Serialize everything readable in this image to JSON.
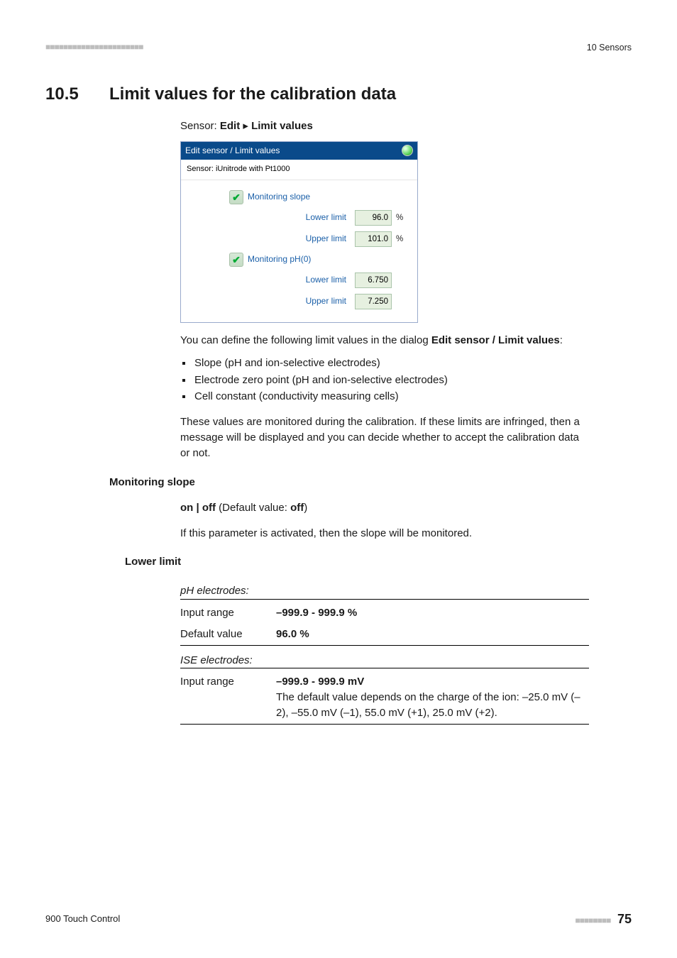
{
  "header": {
    "chapter_ref": "10 Sensors"
  },
  "section": {
    "number": "10.5",
    "title": "Limit values for the calibration data"
  },
  "breadcrumb": {
    "prefix": "Sensor: ",
    "b1": "Edit",
    "sep": " ▸ ",
    "b2": "Limit values"
  },
  "panel": {
    "title": "Edit sensor / Limit values",
    "sensor_line": "Sensor:  iUnitrode with Pt1000",
    "mon_slope_label": "Monitoring slope",
    "lower_label": "Lower limit",
    "upper_label": "Upper limit",
    "slope_lower_val": "96.0",
    "slope_upper_val": "101.0",
    "slope_unit": "%",
    "mon_ph0_label": "Monitoring pH(0)",
    "ph0_lower_val": "6.750",
    "ph0_upper_val": "7.250"
  },
  "para1_a": "You can define the following limit values in the dialog ",
  "para1_b": "Edit sensor / Limit values",
  "para1_c": ":",
  "bullets": [
    "Slope (pH and ion-selective electrodes)",
    "Electrode zero point (pH and ion-selective electrodes)",
    "Cell constant (conductivity measuring cells)"
  ],
  "para2": "These values are monitored during the calibration. If these limits are infringed, then a message will be displayed and you can decide whether to accept the calibration data or not.",
  "mon_slope": {
    "heading": "Monitoring slope",
    "line1_a": "on | off",
    "line1_b": " (Default value: ",
    "line1_c": "off",
    "line1_d": ")",
    "line2": "If this parameter is activated, then the slope will be monitored."
  },
  "lower_limit": {
    "heading": "Lower limit",
    "ph_label": "pH electrodes:",
    "ph_input_k": "Input range",
    "ph_input_v": "–999.9 - 999.9 %",
    "ph_def_k": "Default value",
    "ph_def_v": "96.0 %",
    "ise_label": "ISE electrodes:",
    "ise_input_k": "Input range",
    "ise_input_v": "–999.9 - 999.9 mV",
    "ise_note": "The default value depends on the charge of the ion: –25.0 mV (–2), –55.0 mV (–1), 55.0 mV (+1), 25.0 mV (+2)."
  },
  "footer": {
    "product": "900 Touch Control",
    "page": "75"
  }
}
